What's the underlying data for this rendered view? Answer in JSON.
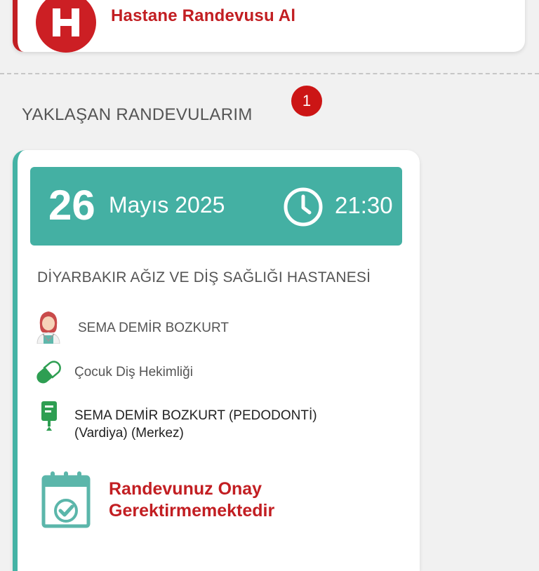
{
  "top_action": {
    "logo_letter": "H",
    "label": "Hastane Randevusu Al"
  },
  "upcoming": {
    "title": "YAKLAŞAN RANDEVULARIM",
    "count": "1"
  },
  "appointment": {
    "day": "26",
    "month_year": "Mayıs 2025",
    "time": "21:30",
    "hospital": "DİYARBAKIR AĞIZ VE DİŞ SAĞLIĞI HASTANESİ",
    "doctor": "SEMA DEMİR BOZKURT",
    "department": "Çocuk Diş Hekimliği",
    "clinic_line1": "SEMA DEMİR BOZKURT (PEDODONTİ)",
    "clinic_line2": "(Vardiya) (Merkez)",
    "status_line1": "Randevunuz Onay",
    "status_line2": "Gerektirmemektedir"
  },
  "icons": {
    "hospital": "hospital-h-icon",
    "clock": "clock-icon",
    "doctor": "female-doctor-icon",
    "department": "capsule-icon",
    "clinic": "iv-drip-icon",
    "status": "calendar-check-icon"
  },
  "colors": {
    "brand_red": "#c21e22",
    "teal": "#44b0a3",
    "badge_red": "#cc1515",
    "background": "#f1f1f1"
  }
}
